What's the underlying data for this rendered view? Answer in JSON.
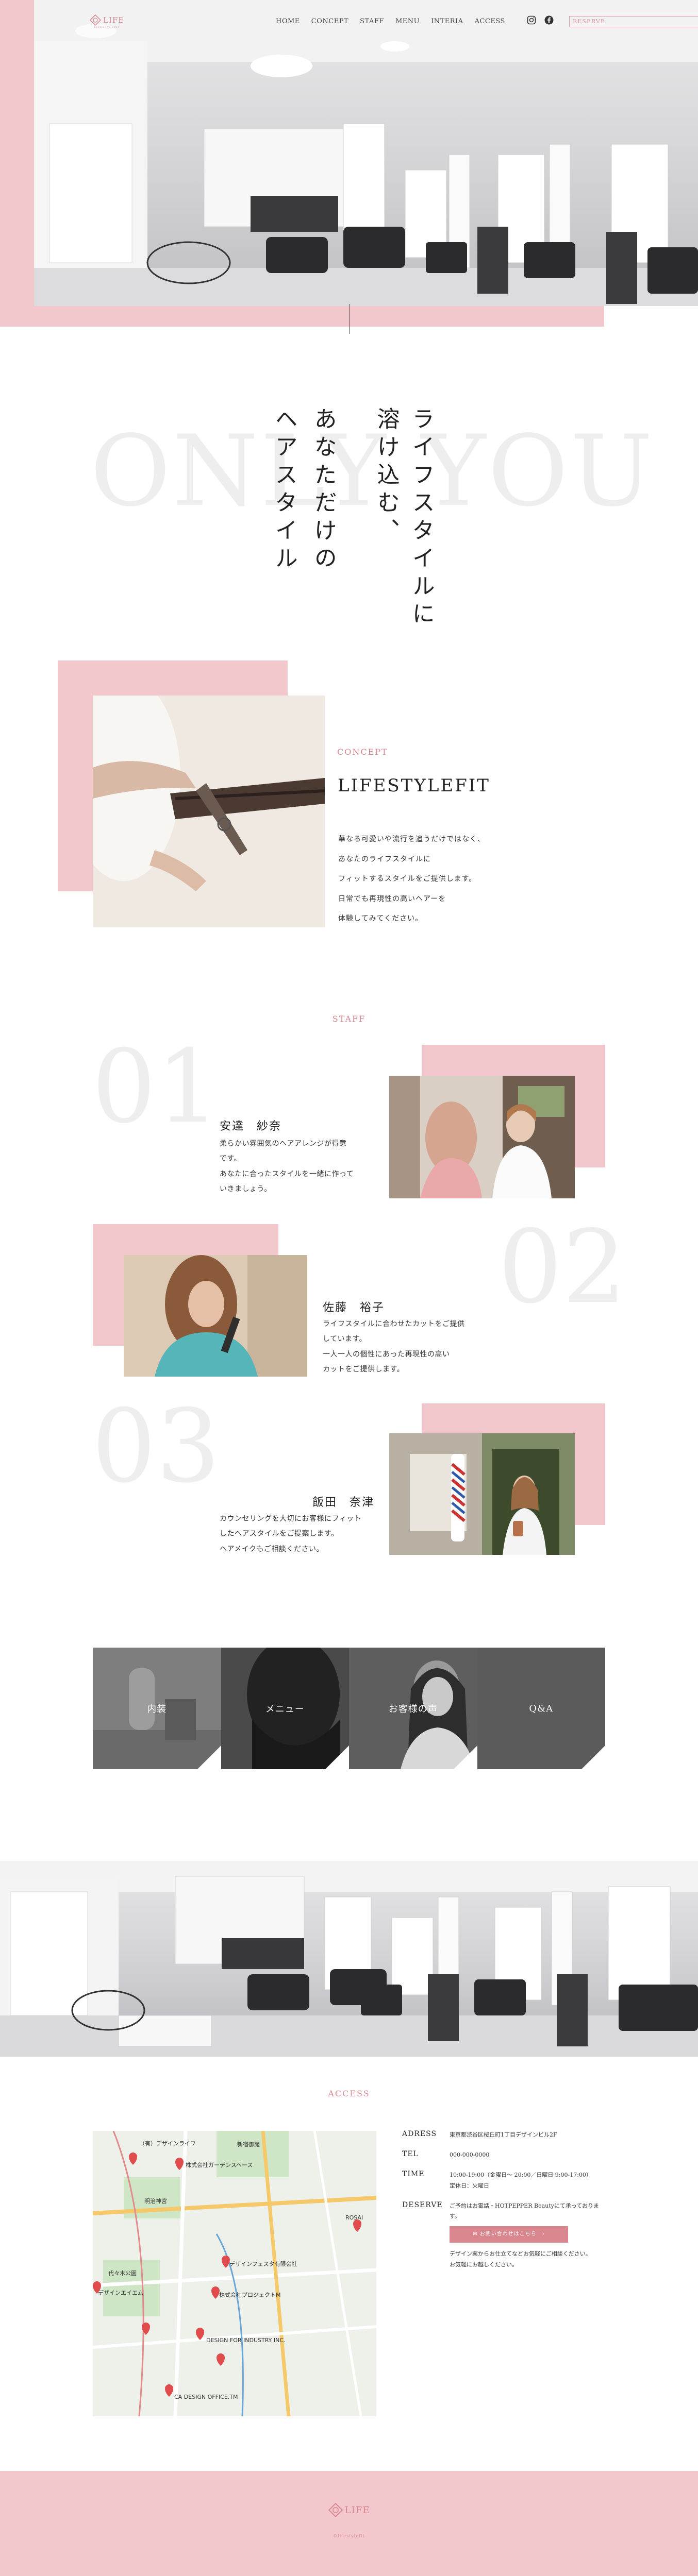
{
  "header": {
    "logo_text": "LIFE",
    "logo_sub": "LIFESTYLEFIT",
    "nav": [
      "HOME",
      "CONCEPT",
      "STAFF",
      "MENU",
      "INTERIA",
      "ACCESS"
    ],
    "reserve_label": "RESERVE"
  },
  "hero": {
    "bg_word": "ONLY YOU",
    "lines": [
      "ライフスタイルに",
      "溶け込む、",
      "あなただけの",
      "ヘアスタイル"
    ]
  },
  "concept": {
    "label": "CONCEPT",
    "title": "LIFESTYLEFIT",
    "text": [
      "華なる可愛いや流行を追うだけではなく、",
      "あなたのライフスタイルに",
      "フィットするスタイルをご提供します。",
      "日常でも再現性の高いヘアーを",
      "体験してみてください。"
    ]
  },
  "staff": {
    "label": "STAFF",
    "members": [
      {
        "num": "01",
        "name": "安達　紗奈",
        "desc": [
          "柔らかい雰囲気のヘアアレンジが得意",
          "です。",
          "あなたに合ったスタイルを一緒に作って",
          "いきましょう。"
        ]
      },
      {
        "num": "02",
        "name": "佐藤　裕子",
        "desc": [
          "ライフスタイルに合わせたカットをご提供",
          "しています。",
          "一人一人の個性にあった再現性の高い",
          "カットをご提供します。"
        ]
      },
      {
        "num": "03",
        "name": "飯田　奈津",
        "desc": [
          "カウンセリングを大切にお客様にフィット",
          "したヘアスタイルをご提案します。",
          "ヘアメイクもご相談ください。"
        ]
      }
    ]
  },
  "menu_tiles": [
    "内装",
    "メニュー",
    "お客様の声",
    "Q&A"
  ],
  "access": {
    "label": "ACCESS",
    "rows": [
      {
        "key": "ADRESS",
        "val": "東京都渋谷区桜丘町1丁目デザインビル2F"
      },
      {
        "key": "TEL",
        "val": "000-000-0000"
      },
      {
        "key": "TIME",
        "val": "10:00-19:00（金曜日〜 20:00／日曜日 9:00-17:00）",
        "val2": "定休日：火曜日"
      },
      {
        "key": "DESERVE",
        "val": "ご予約はお電話・HOTPEPPER Beautyにて承っております。"
      }
    ],
    "button": "お問い合わせはこちら",
    "note": [
      "デザイン案からお仕立てなどお気軽にご相談ください。",
      "お気軽にお越しください。"
    ],
    "map_labels": [
      "（有）デザインライフ",
      "株式会社ガーデンスペース",
      "デザインフェスタ有限会社",
      "株式会社プロジェクトM",
      "デザインエイエム",
      "DESIGN FOR INDUSTRY INC.",
      "CA DESIGN OFFICE.TM",
      "ROSAI",
      "新宿御苑",
      "明治神宮",
      "代々木公園"
    ]
  },
  "footer": {
    "logo_text": "LIFE",
    "copyright": "©lifestylefit"
  }
}
